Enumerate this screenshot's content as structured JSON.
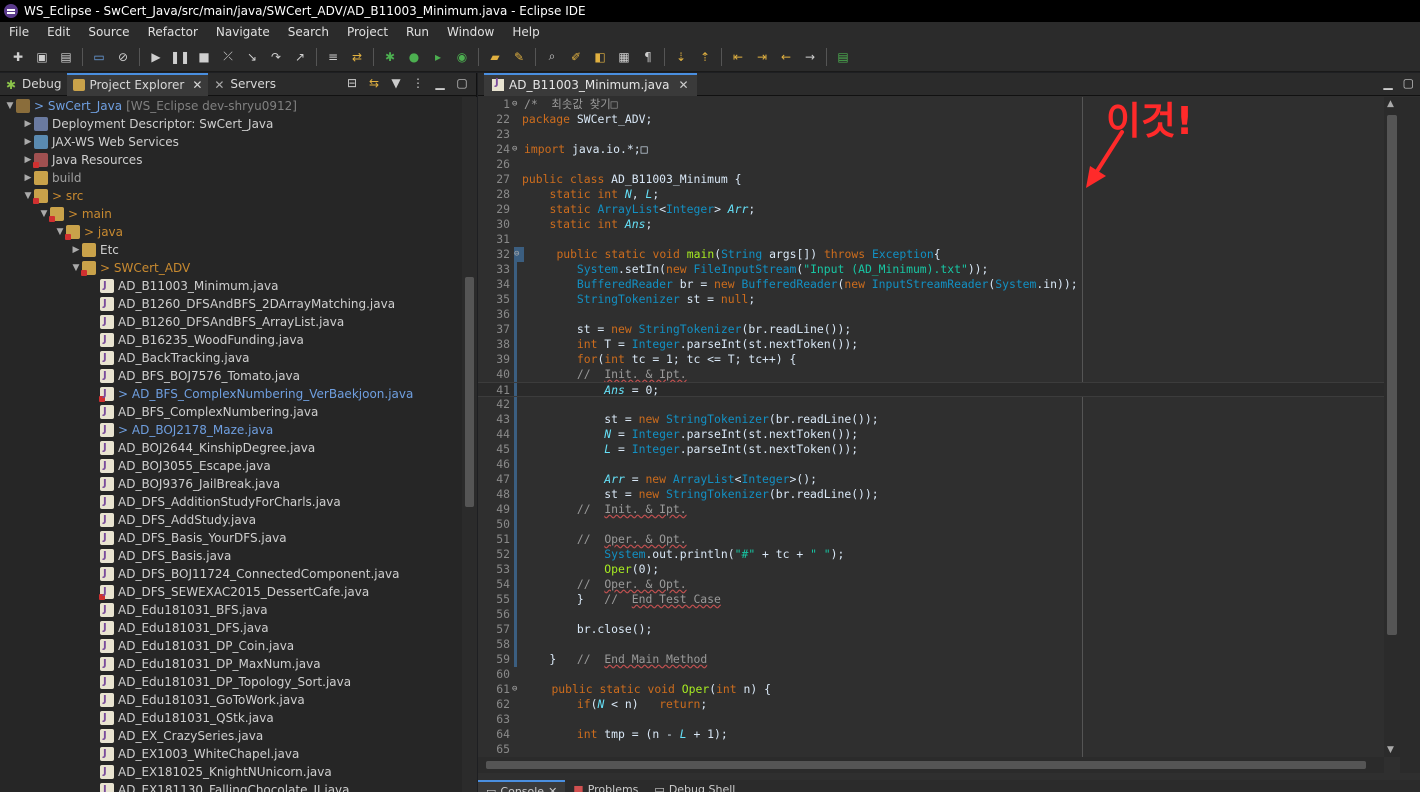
{
  "window": {
    "title": "WS_Eclipse - SwCert_Java/src/main/java/SWCert_ADV/AD_B11003_Minimum.java - Eclipse IDE"
  },
  "menu": [
    "File",
    "Edit",
    "Source",
    "Refactor",
    "Navigate",
    "Search",
    "Project",
    "Run",
    "Window",
    "Help"
  ],
  "left_tabs": [
    {
      "label": "Debug",
      "icon": "bug-icon"
    },
    {
      "label": "Project Explorer",
      "icon": "folder-icon"
    },
    {
      "label": "Servers",
      "icon": "server-icon"
    }
  ],
  "tree": {
    "project": {
      "label": "SwCert_Java",
      "suffix": "[WS_Eclipse dev-shryu0912]"
    },
    "nodes": [
      {
        "label": "Deployment Descriptor: SwCert_Java"
      },
      {
        "label": "JAX-WS Web Services"
      },
      {
        "label": "Java Resources"
      },
      {
        "label": "build"
      },
      {
        "label": "> src"
      },
      {
        "label": "> main"
      },
      {
        "label": "> java"
      },
      {
        "label": "Etc"
      },
      {
        "label": "> SWCert_ADV"
      }
    ],
    "files": [
      "AD_B11003_Minimum.java",
      "AD_B1260_DFSAndBFS_2DArrayMatching.java",
      "AD_B1260_DFSAndBFS_ArrayList.java",
      "AD_B16235_WoodFunding.java",
      "AD_BackTracking.java",
      "AD_BFS_BOJ7576_Tomato.java",
      "> AD_BFS_ComplexNumbering_VerBaekjoon.java",
      "AD_BFS_ComplexNumbering.java",
      "> AD_BOJ2178_Maze.java",
      "AD_BOJ2644_KinshipDegree.java",
      "AD_BOJ3055_Escape.java",
      "AD_BOJ9376_JailBreak.java",
      "AD_DFS_AdditionStudyForCharls.java",
      "AD_DFS_AddStudy.java",
      "AD_DFS_Basis_YourDFS.java",
      "AD_DFS_Basis.java",
      "AD_DFS_BOJ11724_ConnectedComponent.java",
      "AD_DFS_SEWEXAC2015_DessertCafe.java",
      "AD_Edu181031_BFS.java",
      "AD_Edu181031_DFS.java",
      "AD_Edu181031_DP_Coin.java",
      "AD_Edu181031_DP_MaxNum.java",
      "AD_Edu181031_DP_Topology_Sort.java",
      "AD_Edu181031_GoToWork.java",
      "AD_Edu181031_QStk.java",
      "AD_EX_CrazySeries.java",
      "AD_EX1003_WhiteChapel.java",
      "AD_EX181025_KnightNUnicorn.java",
      "AD_EX181130_FallingChocolate_II.java"
    ]
  },
  "editor": {
    "tab_label": "AD_B11003_Minimum.java",
    "lines": [
      {
        "n": "1",
        "fold": true,
        "t": "/*  최솟값 찾기□"
      },
      {
        "n": "22",
        "t": "package SWCert_ADV;"
      },
      {
        "n": "23",
        "t": ""
      },
      {
        "n": "24",
        "fold": true,
        "t": "import java.io.*;□"
      },
      {
        "n": "26",
        "t": ""
      },
      {
        "n": "27",
        "t": "public class AD_B11003_Minimum {"
      },
      {
        "n": "28",
        "t": "    static int N, L;"
      },
      {
        "n": "29",
        "t": "    static ArrayList<Integer> Arr;"
      },
      {
        "n": "30",
        "t": "    static int Ans;"
      },
      {
        "n": "31",
        "t": ""
      },
      {
        "n": "32",
        "fold": true,
        "t": "    public static void main(String args[]) throws Exception{"
      },
      {
        "n": "33",
        "t": "        System.setIn(new FileInputStream(\"Input (AD_Minimum).txt\"));"
      },
      {
        "n": "34",
        "t": "        BufferedReader br = new BufferedReader(new InputStreamReader(System.in));"
      },
      {
        "n": "35",
        "t": "        StringTokenizer st = null;"
      },
      {
        "n": "36",
        "t": ""
      },
      {
        "n": "37",
        "t": "        st = new StringTokenizer(br.readLine());"
      },
      {
        "n": "38",
        "t": "        int T = Integer.parseInt(st.nextToken());"
      },
      {
        "n": "39",
        "t": "        for(int tc = 1; tc <= T; tc++) {"
      },
      {
        "n": "40",
        "t": "        //  Init. & Ipt."
      },
      {
        "n": "41",
        "t": "            Ans = 0;"
      },
      {
        "n": "42",
        "t": ""
      },
      {
        "n": "43",
        "t": "            st = new StringTokenizer(br.readLine());"
      },
      {
        "n": "44",
        "t": "            N = Integer.parseInt(st.nextToken());"
      },
      {
        "n": "45",
        "t": "            L = Integer.parseInt(st.nextToken());"
      },
      {
        "n": "46",
        "t": ""
      },
      {
        "n": "47",
        "t": "            Arr = new ArrayList<Integer>();"
      },
      {
        "n": "48",
        "t": "            st = new StringTokenizer(br.readLine());"
      },
      {
        "n": "49",
        "t": "        //  Init. & Ipt."
      },
      {
        "n": "50",
        "t": ""
      },
      {
        "n": "51",
        "t": "        //  Oper. & Opt."
      },
      {
        "n": "52",
        "t": "            System.out.println(\"#\" + tc + \" \");"
      },
      {
        "n": "53",
        "t": "            Oper(0);"
      },
      {
        "n": "54",
        "t": "        //  Oper. & Opt."
      },
      {
        "n": "55",
        "t": "        }   //  End Test Case"
      },
      {
        "n": "56",
        "t": ""
      },
      {
        "n": "57",
        "t": "        br.close();"
      },
      {
        "n": "58",
        "t": ""
      },
      {
        "n": "59",
        "t": "    }   //  End Main Method"
      },
      {
        "n": "60",
        "t": ""
      },
      {
        "n": "61",
        "fold": true,
        "t": "    public static void Oper(int n) {"
      },
      {
        "n": "62",
        "t": "        if(N < n)   return;"
      },
      {
        "n": "63",
        "t": ""
      },
      {
        "n": "64",
        "t": "        int tmp = (n - L + 1);"
      },
      {
        "n": "65",
        "t": ""
      }
    ]
  },
  "annotation": {
    "text": "이것!",
    "color": "#ff2a2a"
  },
  "bottom_tabs": [
    "Console",
    "Problems",
    "Debug Shell"
  ]
}
